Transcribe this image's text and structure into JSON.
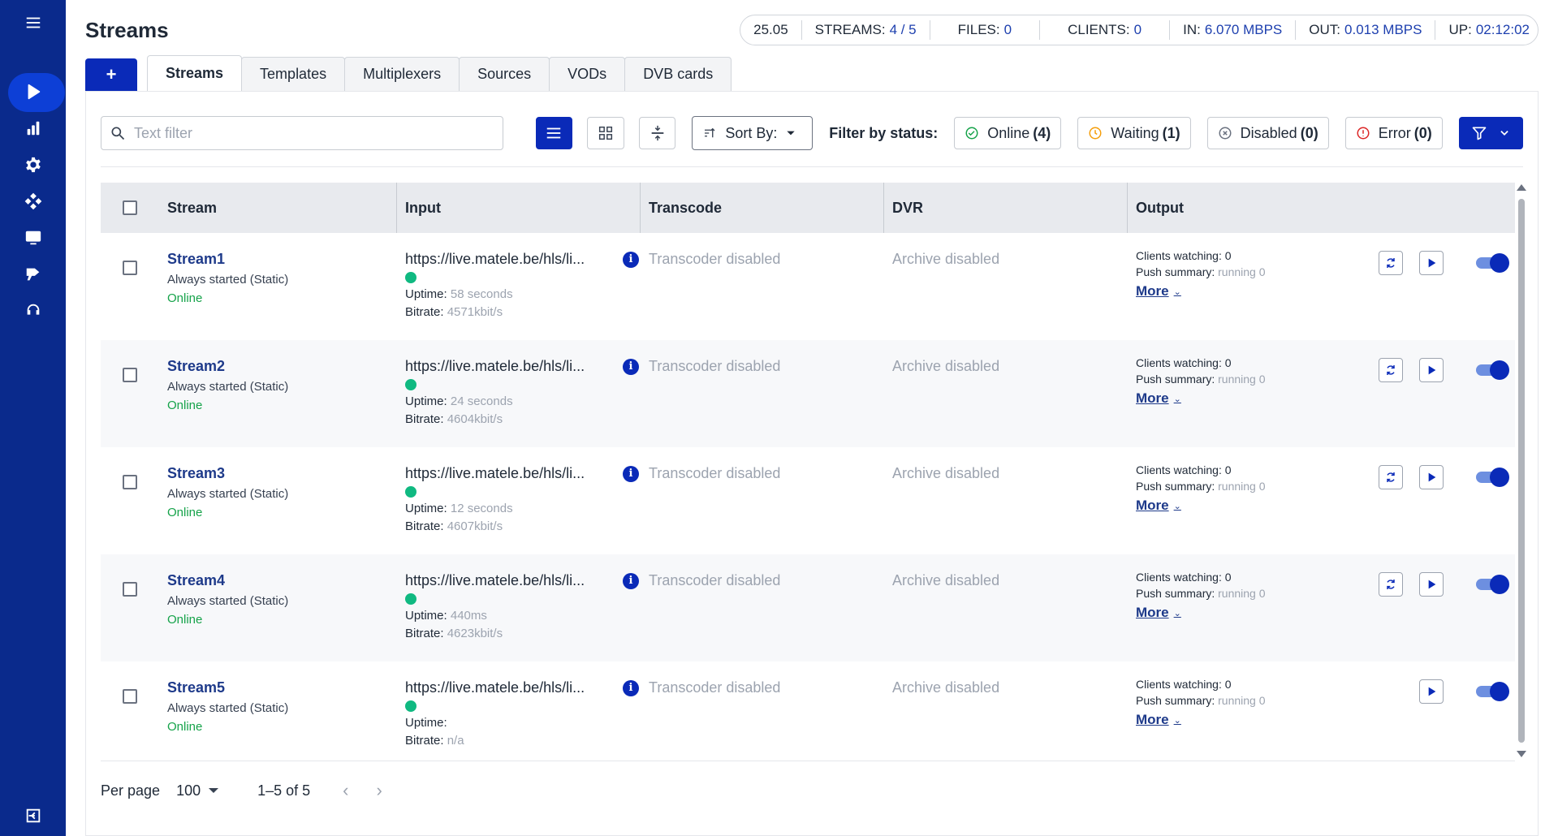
{
  "sidebar": {
    "items": [
      {
        "icon": "menu-icon"
      },
      {
        "icon": "play-icon",
        "active": true
      },
      {
        "icon": "chart-icon"
      },
      {
        "icon": "gear-icon"
      },
      {
        "icon": "nodes-icon"
      },
      {
        "icon": "monitor-icon"
      },
      {
        "icon": "broadcast-icon"
      },
      {
        "icon": "headset-icon"
      },
      {
        "icon": "collapse-icon"
      }
    ]
  },
  "header": {
    "title": "Streams",
    "status": {
      "version": "25.05",
      "streams_label": "STREAMS:",
      "streams_value": "4 / 5",
      "files_label": "FILES:",
      "files_value": "0",
      "clients_label": "CLIENTS:",
      "clients_value": "0",
      "in_label": "IN:",
      "in_value": "6.070 MBPS",
      "out_label": "OUT:",
      "out_value": "0.013 MBPS",
      "up_label": "UP:",
      "up_value": "02:12:02"
    }
  },
  "tabs": {
    "add_label": "+",
    "items": [
      "Streams",
      "Templates",
      "Multiplexers",
      "Sources",
      "VODs",
      "DVB cards"
    ]
  },
  "toolbar": {
    "search_placeholder": "Text filter",
    "sort_label": "Sort By:",
    "filter_label": "Filter by status:",
    "filters": [
      {
        "label": "Online",
        "count": "(4)",
        "color": "#16a34a"
      },
      {
        "label": "Waiting",
        "count": "(1)",
        "color": "#f59e0b"
      },
      {
        "label": "Disabled",
        "count": "(0)",
        "color": "#6b7280"
      },
      {
        "label": "Error",
        "count": "(0)",
        "color": "#dc2626"
      }
    ]
  },
  "table": {
    "headers": [
      "Stream",
      "Input",
      "Transcode",
      "DVR",
      "Output"
    ],
    "rows": [
      {
        "name": "Stream1",
        "mode": "Always started (Static)",
        "status": "Online",
        "url": "https://live.matele.be/hls/li...",
        "uptime_label": "Uptime:",
        "uptime": "58 seconds",
        "bitrate_label": "Bitrate:",
        "bitrate": "4571kbit/s",
        "transcode": "Transcoder disabled",
        "dvr": "Archive disabled",
        "clients_label": "Clients watching:",
        "clients": "0",
        "push_label": "Push summary:",
        "push": "running 0",
        "more": "More"
      },
      {
        "name": "Stream2",
        "mode": "Always started (Static)",
        "status": "Online",
        "url": "https://live.matele.be/hls/li...",
        "uptime_label": "Uptime:",
        "uptime": "24 seconds",
        "bitrate_label": "Bitrate:",
        "bitrate": "4604kbit/s",
        "transcode": "Transcoder disabled",
        "dvr": "Archive disabled",
        "clients_label": "Clients watching:",
        "clients": "0",
        "push_label": "Push summary:",
        "push": "running 0",
        "more": "More"
      },
      {
        "name": "Stream3",
        "mode": "Always started (Static)",
        "status": "Online",
        "url": "https://live.matele.be/hls/li...",
        "uptime_label": "Uptime:",
        "uptime": "12 seconds",
        "bitrate_label": "Bitrate:",
        "bitrate": "4607kbit/s",
        "transcode": "Transcoder disabled",
        "dvr": "Archive disabled",
        "clients_label": "Clients watching:",
        "clients": "0",
        "push_label": "Push summary:",
        "push": "running 0",
        "more": "More"
      },
      {
        "name": "Stream4",
        "mode": "Always started (Static)",
        "status": "Online",
        "url": "https://live.matele.be/hls/li...",
        "uptime_label": "Uptime:",
        "uptime": "440ms",
        "bitrate_label": "Bitrate:",
        "bitrate": "4623kbit/s",
        "transcode": "Transcoder disabled",
        "dvr": "Archive disabled",
        "clients_label": "Clients watching:",
        "clients": "0",
        "push_label": "Push summary:",
        "push": "running 0",
        "more": "More"
      },
      {
        "name": "Stream5",
        "mode": "Always started (Static)",
        "status": "Online",
        "url": "https://live.matele.be/hls/li...",
        "uptime_label": "Uptime:",
        "uptime": "",
        "bitrate_label": "Bitrate:",
        "bitrate": "n/a",
        "transcode": "Transcoder disabled",
        "dvr": "Archive disabled",
        "clients_label": "Clients watching:",
        "clients": "0",
        "push_label": "Push summary:",
        "push": "running 0",
        "more": "More"
      }
    ]
  },
  "pager": {
    "per_page_label": "Per page",
    "per_page_value": "100",
    "range": "1–5 of 5",
    "prev": "‹",
    "next": "›"
  }
}
